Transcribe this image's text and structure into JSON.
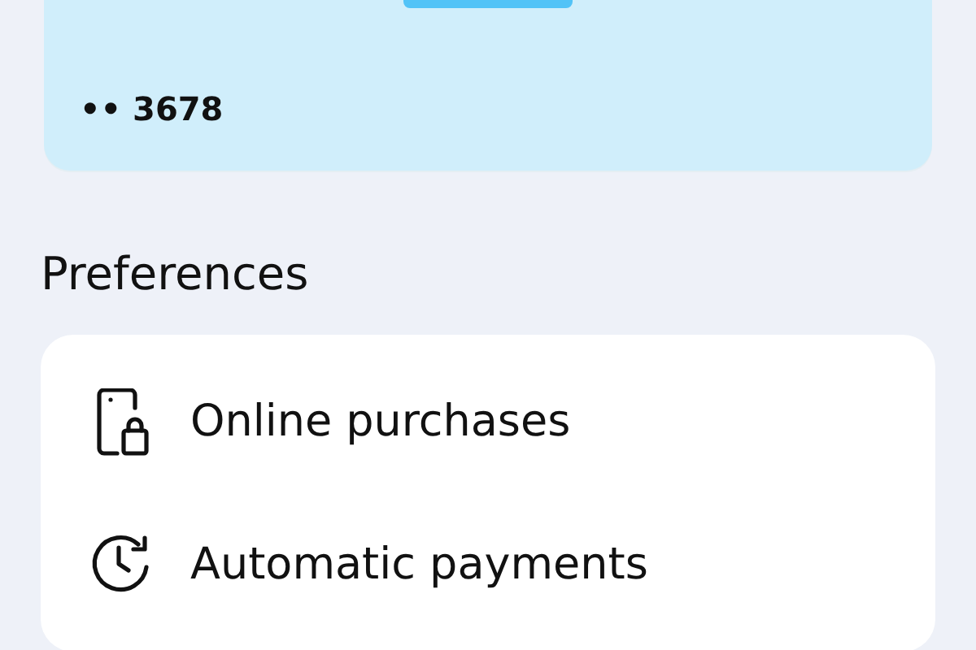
{
  "card": {
    "number": "•• 3678"
  },
  "preferences": {
    "title": "Preferences",
    "items": [
      {
        "kind": "device",
        "label": "Online purchases"
      },
      {
        "kind": "schedule",
        "label": "Automatic payments"
      }
    ]
  }
}
